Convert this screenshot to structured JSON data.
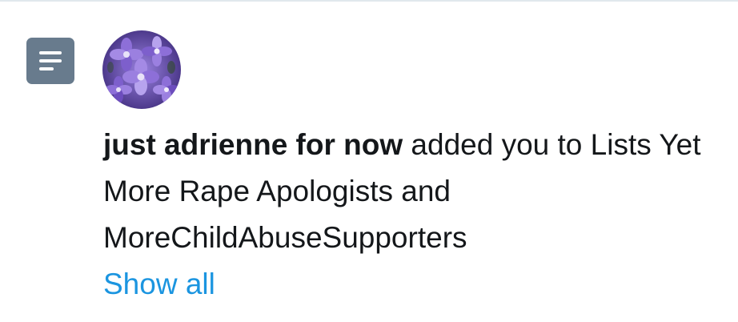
{
  "notification": {
    "icon": "list-icon",
    "avatar": {
      "icon": "purple-flowers-avatar",
      "colors": [
        "#6c4dbd",
        "#8d6fd8",
        "#b7a3ee",
        "#3d2a7a",
        "#e8e2f8"
      ]
    },
    "actor_name": "just adrienne for now",
    "action_text": " added you to Lists Yet More Rape Apologists and MoreChildAbuseSupporters",
    "show_all_label": "Show all"
  },
  "colors": {
    "text": "#14171a",
    "link": "#1b95e0",
    "icon_bg": "#687b8d",
    "divider": "#e1e8ed"
  }
}
